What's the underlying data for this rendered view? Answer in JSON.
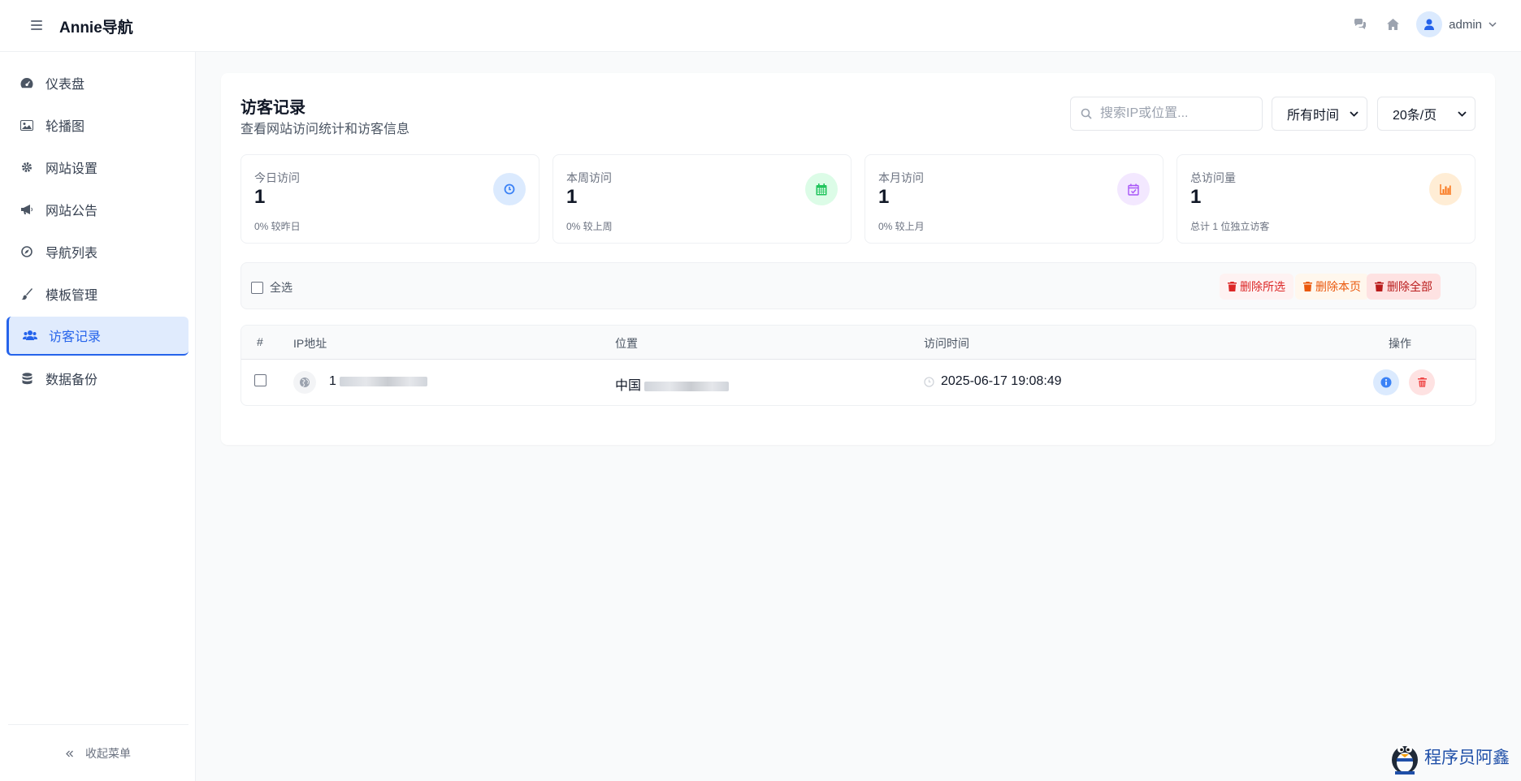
{
  "app": {
    "title": "Annie导航"
  },
  "header": {
    "username": "admin"
  },
  "sidebar": {
    "items": [
      {
        "label": "仪表盘"
      },
      {
        "label": "轮播图"
      },
      {
        "label": "网站设置"
      },
      {
        "label": "网站公告"
      },
      {
        "label": "导航列表"
      },
      {
        "label": "模板管理"
      },
      {
        "label": "访客记录"
      },
      {
        "label": "数据备份"
      }
    ],
    "collapse_label": "收起菜单"
  },
  "page": {
    "title": "访客记录",
    "subtitle": "查看网站访问统计和访客信息",
    "search_placeholder": "搜索IP或位置...",
    "time_filter": "所有时间",
    "page_size": "20条/页"
  },
  "stats": [
    {
      "label": "今日访问",
      "value": "1",
      "compare": "0% 较昨日",
      "color": "#3b82f6"
    },
    {
      "label": "本周访问",
      "value": "1",
      "compare": "0% 较上周",
      "color": "#22c55e"
    },
    {
      "label": "本月访问",
      "value": "1",
      "compare": "0% 较上月",
      "color": "#a855f7"
    },
    {
      "label": "总访问量",
      "value": "1",
      "compare": "总计 1 位独立访客",
      "color": "#f97316"
    }
  ],
  "toolbar": {
    "select_all": "全选",
    "delete_selected": "删除所选",
    "delete_page": "删除本页",
    "delete_all": "删除全部"
  },
  "table": {
    "columns": {
      "index": "#",
      "ip": "IP地址",
      "location": "位置",
      "time": "访问时间",
      "actions": "操作"
    },
    "rows": [
      {
        "ip": "1",
        "location": "中国",
        "time": "2025-06-17 19:08:49"
      }
    ]
  },
  "watermark": {
    "text": "程序员阿鑫"
  },
  "colors": {
    "accent": "#2563eb",
    "danger": "#dc2626",
    "warning": "#ea580c"
  }
}
